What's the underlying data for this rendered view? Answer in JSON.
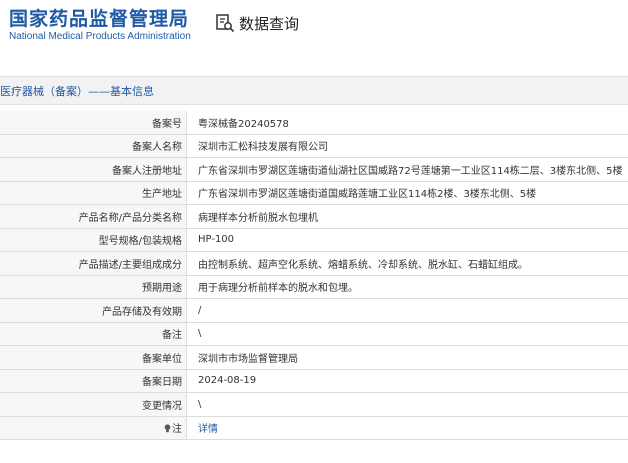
{
  "header": {
    "title_cn": "国家药品监督管理局",
    "title_en": "National Medical Products Administration",
    "query_label": "数据查询",
    "query_icon": "document-search-icon"
  },
  "section": {
    "title": "医疗器械（备案）——基本信息"
  },
  "rows": [
    {
      "label": "备案号",
      "value": "粤深械备20240578"
    },
    {
      "label": "备案人名称",
      "value": "深圳市汇松科技发展有限公司"
    },
    {
      "label": "备案人注册地址",
      "value": "广东省深圳市罗湖区莲塘街道仙湖社区国威路72号莲塘第一工业区114栋二层、3楼东北侧、5楼"
    },
    {
      "label": "生产地址",
      "value": "广东省深圳市罗湖区莲塘街道国威路莲塘工业区114栋2楼、3楼东北侧、5楼"
    },
    {
      "label": "产品名称/产品分类名称",
      "value": "病理样本分析前脱水包埋机"
    },
    {
      "label": "型号规格/包装规格",
      "value": "HP-100"
    },
    {
      "label": "产品描述/主要组成成分",
      "value": "由控制系统、超声空化系统、熔蜡系统、冷却系统、脱水缸、石蜡缸组成。"
    },
    {
      "label": "预期用途",
      "value": "用于病理分析前样本的脱水和包埋。"
    },
    {
      "label": "产品存储及有效期",
      "value": "/"
    },
    {
      "label": "备注",
      "value": "\\"
    },
    {
      "label": "备案单位",
      "value": "深圳市市场监督管理局"
    },
    {
      "label": "备案日期",
      "value": "2024-08-19"
    },
    {
      "label": "变更情况",
      "value": "\\"
    },
    {
      "label": "注",
      "value": "详情",
      "label_icon": "lightbulb-icon"
    }
  ],
  "colors": {
    "brand": "#1f5aa6",
    "link": "#1f5aa6"
  }
}
